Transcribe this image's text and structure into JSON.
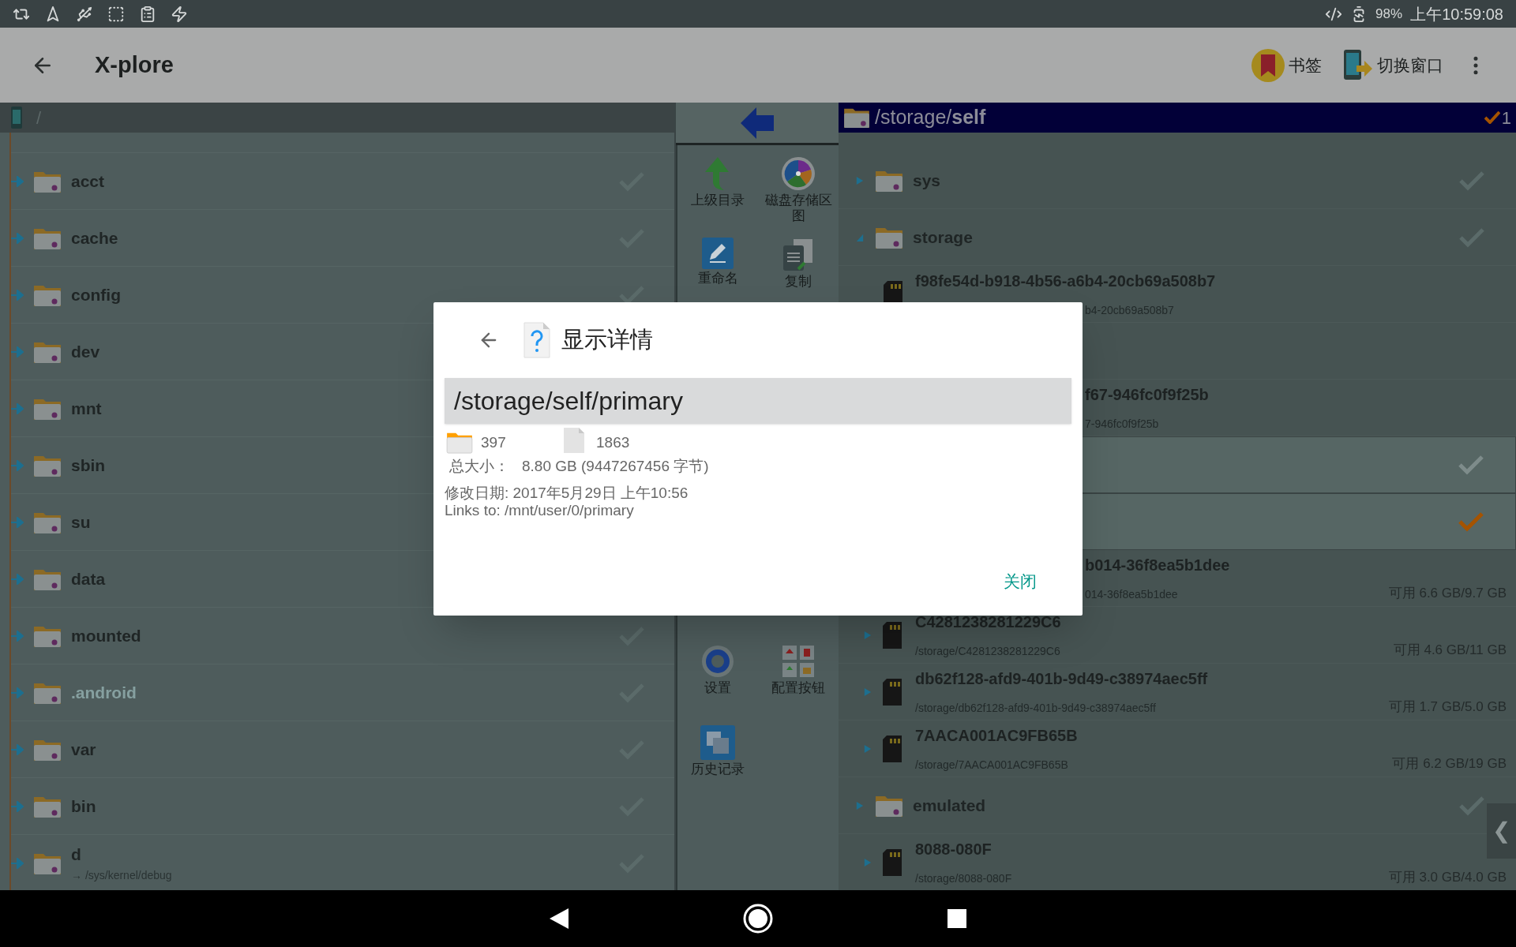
{
  "status_bar": {
    "battery": "98%",
    "time": "上午10:59:08"
  },
  "app_bar": {
    "title": "X-plore",
    "actions": [
      {
        "kind": "bookmark",
        "label": "书签"
      },
      {
        "kind": "switch",
        "label": "切换窗口"
      }
    ]
  },
  "left_panel": {
    "path": "/",
    "items": [
      {
        "name": "acct",
        "hidden": false
      },
      {
        "name": "cache",
        "hidden": false
      },
      {
        "name": "config",
        "hidden": false
      },
      {
        "name": "dev",
        "hidden": false
      },
      {
        "name": "mnt",
        "hidden": false
      },
      {
        "name": "sbin",
        "hidden": false
      },
      {
        "name": "su",
        "hidden": false
      },
      {
        "name": "data",
        "hidden": false
      },
      {
        "name": "mounted",
        "hidden": false
      },
      {
        "name": ".android",
        "hidden": true
      },
      {
        "name": "var",
        "hidden": false
      },
      {
        "name": "bin",
        "hidden": false
      },
      {
        "name": "d",
        "hidden": false,
        "link": "→ /sys/kernel/debug"
      }
    ]
  },
  "toolbar": {
    "tools": [
      {
        "kind": "up",
        "label": "上级目录"
      },
      {
        "kind": "disk-map",
        "label": "磁盘存储区图"
      },
      {
        "kind": "rename",
        "label": "重命名"
      },
      {
        "kind": "copy",
        "label": "复制"
      },
      {
        "kind": "covered"
      },
      {
        "kind": "covered"
      },
      {
        "kind": "covered"
      },
      {
        "kind": "covered"
      },
      {
        "kind": "covered"
      },
      {
        "kind": "covered"
      },
      {
        "kind": "covered"
      },
      {
        "kind": "covered"
      },
      {
        "kind": "settings",
        "label": "设置"
      },
      {
        "kind": "buttons",
        "label": "配置按钮"
      },
      {
        "kind": "history",
        "label": "历史记录"
      }
    ]
  },
  "right_panel": {
    "path": "/storage/**self**",
    "marked_count": "1",
    "handle": "❮",
    "items": [
      {
        "kind": "folder",
        "name": "sys",
        "expanded": false,
        "marked": false
      },
      {
        "kind": "folder",
        "name": "storage",
        "expanded": true,
        "marked": false
      },
      {
        "kind": "halfclipped",
        "name": "f98fe54d-b918-4b56-a6b4-20cb69a508b7",
        "path": "b4-20cb69a508b7"
      },
      {
        "kind": "blank",
        "selected": false
      },
      {
        "kind": "clipped",
        "name": "f67-946fc0f9f25b",
        "path": "7-946fc0f9f25b"
      },
      {
        "kind": "blank",
        "selected": true,
        "marked": false
      },
      {
        "kind": "blank",
        "selected": true,
        "marked": true
      },
      {
        "kind": "clipped",
        "name": "b014-36f8ea5b1dee",
        "path": "014-36f8ea5b1dee",
        "free": "可用 6.6 GB/9.7 GB"
      },
      {
        "kind": "device",
        "name": "C4281238281229C6",
        "path": "/storage/C4281238281229C6",
        "free": "可用 4.6 GB/11 GB"
      },
      {
        "kind": "device",
        "name": "db62f128-afd9-401b-9d49-c38974aec5ff",
        "path": "/storage/db62f128-afd9-401b-9d49-c38974aec5ff",
        "free": "可用 1.7 GB/5.0 GB"
      },
      {
        "kind": "device",
        "name": "7AACA001AC9FB65B",
        "path": "/storage/7AACA001AC9FB65B",
        "free": "可用 6.2 GB/19 GB"
      },
      {
        "kind": "folder",
        "name": "emulated",
        "expanded": false,
        "marked": false
      },
      {
        "kind": "device",
        "name": "8088-080F",
        "path": "/storage/8088-080F",
        "free": "可用 3.0 GB/4.0 GB"
      }
    ]
  },
  "dialog": {
    "title": "显示详情",
    "path": "/storage/self/primary",
    "folders": "397",
    "files": "1863",
    "size_label": "总大小：",
    "size_value": "8.80 GB (9447267456 字节)",
    "modified": "修改日期: 2017年5月29日 上午10:56",
    "links": "Links to: /mnt/user/0/primary",
    "close": "关闭"
  }
}
